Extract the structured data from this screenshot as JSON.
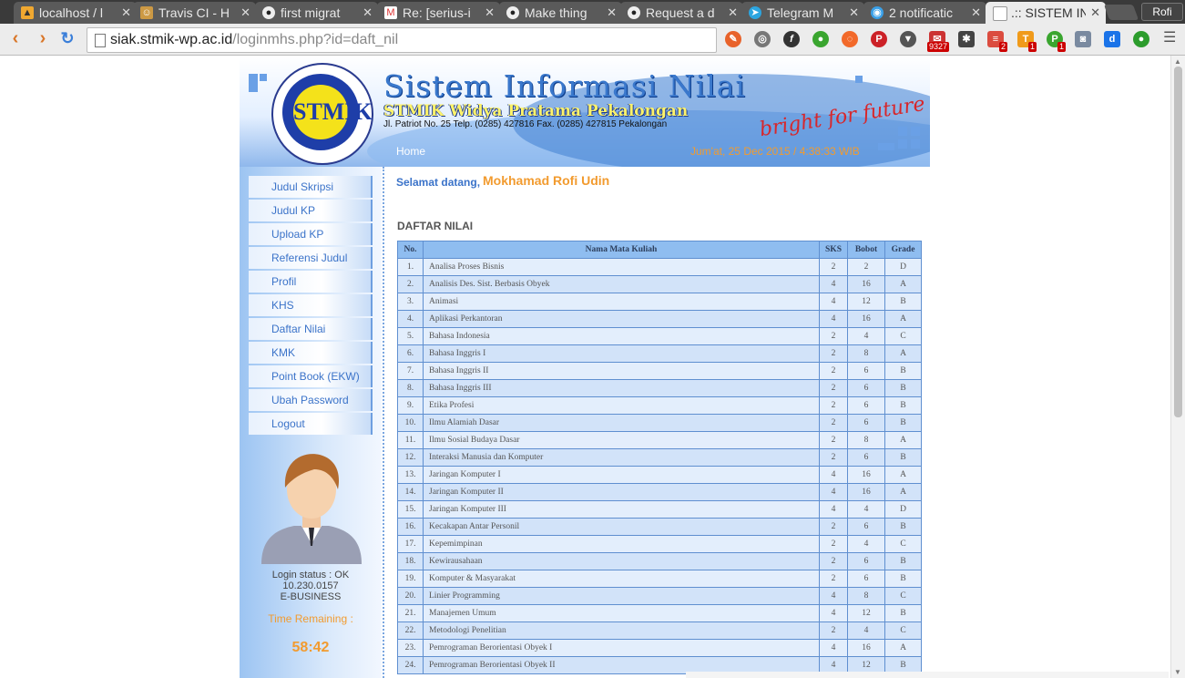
{
  "browser": {
    "tabs": [
      {
        "title": "localhost / l",
        "icon": "phpmyadmin-icon",
        "active": false
      },
      {
        "title": "Travis CI - H",
        "icon": "travis-icon",
        "active": false
      },
      {
        "title": "first migrat",
        "icon": "github-icon",
        "active": false
      },
      {
        "title": "Re: [serius-i",
        "icon": "gmail-icon",
        "active": false
      },
      {
        "title": "Make thing",
        "icon": "github-icon",
        "active": false
      },
      {
        "title": "Request a d",
        "icon": "github-icon",
        "active": false
      },
      {
        "title": "Telegram M",
        "icon": "telegram-icon",
        "active": false
      },
      {
        "title": "2 notificatic",
        "icon": "chat-icon",
        "active": false
      },
      {
        "title": ".:: SISTEM IN",
        "icon": "page-icon",
        "active": true
      }
    ],
    "profile_name": "Rofi",
    "url_host": "siak.stmik-wp.ac.id",
    "url_path": "/loginmhs.php?id=daft_nil",
    "extension_badges": {
      "mail": "9327",
      "todo": "2",
      "t": "1",
      "pb": "1"
    }
  },
  "header": {
    "title": "Sistem Informasi Nilai",
    "subtitle": "STMIK Widya Pratama Pekalongan",
    "address": "Jl. Patriot No. 25 Telp. (0285) 427816 Fax. (0285) 427815 Pekalongan",
    "tagline": "bright for future",
    "logo_text": "STMIK",
    "home_label": "Home",
    "datetime": "Jum'at, 25 Dec 2015 / 4:38:33 WIB"
  },
  "sidebar": {
    "menu": [
      {
        "label": "Judul Skripsi"
      },
      {
        "label": "Judul KP"
      },
      {
        "label": "Upload KP"
      },
      {
        "label": "Referensi Judul"
      },
      {
        "label": "Profil"
      },
      {
        "label": "KHS"
      },
      {
        "label": "Daftar Nilai"
      },
      {
        "label": "KMK"
      },
      {
        "label": "Point Book (EKW)"
      },
      {
        "label": "Ubah Password"
      },
      {
        "label": "Logout"
      }
    ],
    "login_status": "Login status : OK",
    "ip": "10.230.0157",
    "program": "E-BUSINESS",
    "time_remaining_label": "Time Remaining :",
    "time_remaining": "58:42"
  },
  "content": {
    "welcome": "Selamat datang,",
    "username": "Mokhamad Rofi Udin",
    "section_title": "DAFTAR NILAI",
    "columns": [
      "No.",
      "Nama Mata Kuliah",
      "SKS",
      "Bobot",
      "Grade"
    ],
    "rows": [
      [
        "1.",
        "Analisa Proses Bisnis",
        "2",
        "2",
        "D"
      ],
      [
        "2.",
        "Analisis Des. Sist. Berbasis Obyek",
        "4",
        "16",
        "A"
      ],
      [
        "3.",
        "Animasi",
        "4",
        "12",
        "B"
      ],
      [
        "4.",
        "Aplikasi Perkantoran",
        "4",
        "16",
        "A"
      ],
      [
        "5.",
        "Bahasa Indonesia",
        "2",
        "4",
        "C"
      ],
      [
        "6.",
        "Bahasa Inggris I",
        "2",
        "8",
        "A"
      ],
      [
        "7.",
        "Bahasa Inggris II",
        "2",
        "6",
        "B"
      ],
      [
        "8.",
        "Bahasa Inggris III",
        "2",
        "6",
        "B"
      ],
      [
        "9.",
        "Etika Profesi",
        "2",
        "6",
        "B"
      ],
      [
        "10.",
        "Ilmu Alamiah Dasar",
        "2",
        "6",
        "B"
      ],
      [
        "11.",
        "Ilmu Sosial Budaya Dasar",
        "2",
        "8",
        "A"
      ],
      [
        "12.",
        "Interaksi Manusia dan Komputer",
        "2",
        "6",
        "B"
      ],
      [
        "13.",
        "Jaringan Komputer I",
        "4",
        "16",
        "A"
      ],
      [
        "14.",
        "Jaringan Komputer II",
        "4",
        "16",
        "A"
      ],
      [
        "15.",
        "Jaringan Komputer III",
        "4",
        "4",
        "D"
      ],
      [
        "16.",
        "Kecakapan Antar Personil",
        "2",
        "6",
        "B"
      ],
      [
        "17.",
        "Kepemimpinan",
        "2",
        "4",
        "C"
      ],
      [
        "18.",
        "Kewirausahaan",
        "2",
        "6",
        "B"
      ],
      [
        "19.",
        "Komputer & Masyarakat",
        "2",
        "6",
        "B"
      ],
      [
        "20.",
        "Linier Programming",
        "4",
        "8",
        "C"
      ],
      [
        "21.",
        "Manajemen Umum",
        "4",
        "12",
        "B"
      ],
      [
        "22.",
        "Metodologi Penelitian",
        "2",
        "4",
        "C"
      ],
      [
        "23.",
        "Pemrograman Berorientasi Obyek I",
        "4",
        "16",
        "A"
      ],
      [
        "24.",
        "Pemrograman Berorientasi Obyek II",
        "4",
        "12",
        "B"
      ]
    ]
  }
}
